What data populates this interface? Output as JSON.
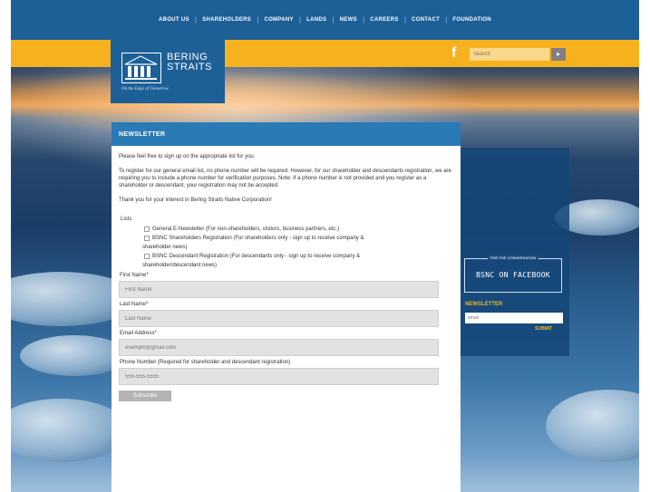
{
  "nav": {
    "items": [
      "ABOUT US",
      "SHAREHOLDERS",
      "COMPANY",
      "LANDS",
      "NEWS",
      "CAREERS",
      "CONTACT",
      "FOUNDATION"
    ],
    "separator": "|"
  },
  "header": {
    "facebook_glyph": "f",
    "search_placeholder": "Search",
    "search_button": "▸"
  },
  "logo": {
    "line1": "BERING",
    "line2": "STRAITS",
    "tagline": "On the Edge of Tomorrow"
  },
  "main": {
    "title": "NEWSLETTER",
    "intro": "Please feel free to sign up on the appropriate list for you.",
    "register_note": "To register for our general email list, no phone number will be required. However, for our shareholder and descendants registration, we are requiring you to include a phone number for verification purposes. Note: If a phone number is not provided and you register as a shareholder or descendant, your registration may not be accepted.",
    "thanks": "Thank you for your interest in Bering Straits Native Corporation!",
    "lists_label": "Lists",
    "lists": [
      {
        "label": "General E-Newsletter (For non-shareholders, visitors, business partners, etc.)"
      },
      {
        "label": "BSNC Shareholders Registration (For shareholders only - sign up to receive company &",
        "cont": "shareholder news)"
      },
      {
        "label": "BSNC Descendant Registration (For descendants only - sign up to receive company &",
        "cont": "shareholder/descendant news)"
      }
    ],
    "fields": {
      "first_name": {
        "label": "First Name*",
        "placeholder": "First Name"
      },
      "last_name": {
        "label": "Last Name*",
        "placeholder": "Last Name"
      },
      "email": {
        "label": "Email Address*",
        "placeholder": "example@gmail.com"
      },
      "phone": {
        "label": "Phone Number (Required for shareholder and descendant registration)",
        "placeholder": "555-555-5555"
      }
    },
    "subscribe_label": "Subscribe"
  },
  "sidebar": {
    "fb_small": "FOR THE CONVERSATION",
    "fb_big": "BSNC ON FACEBOOK",
    "newsletter_label": "NEWSLETTER",
    "email_placeholder": "email",
    "submit_label": "SUBMIT"
  },
  "colors": {
    "nav_blue": "#1d5f97",
    "accent_yellow": "#f6b21e",
    "panel_header": "#2a7ab5"
  },
  "icons": [
    "facebook-icon",
    "search-arrow-icon"
  ]
}
